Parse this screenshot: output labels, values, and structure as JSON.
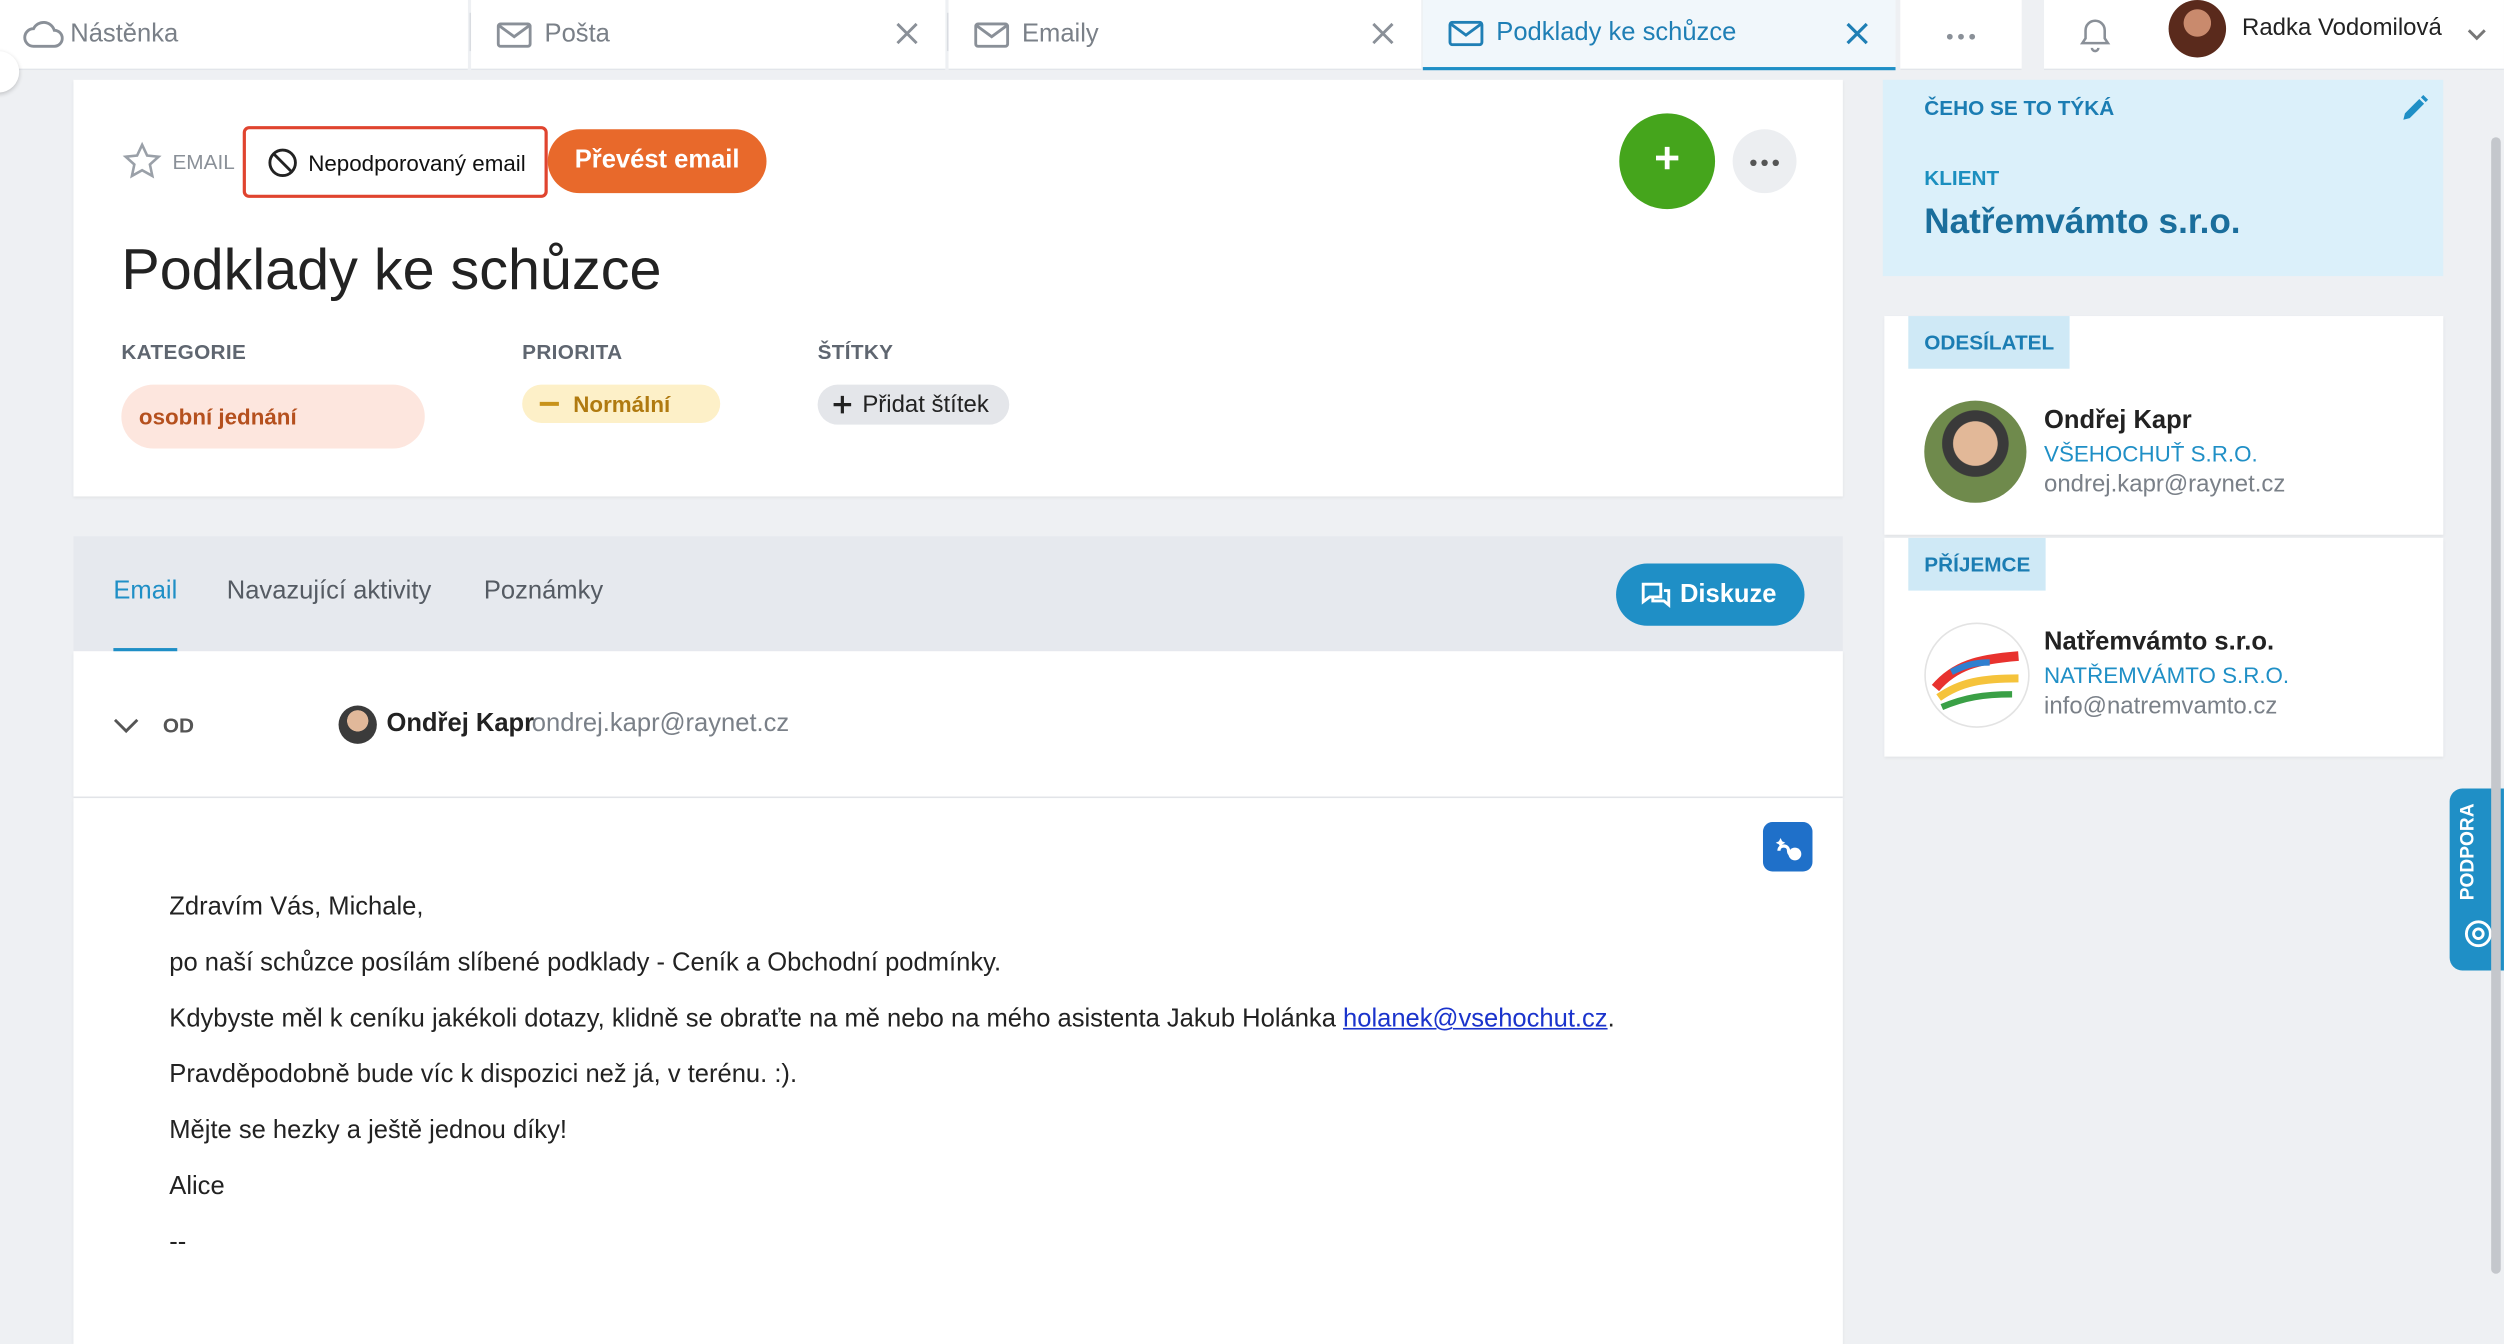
{
  "tabs": [
    {
      "label": "Nástěnka",
      "icon": "cloud-icon"
    },
    {
      "label": "Pošta",
      "icon": "mail-icon"
    },
    {
      "label": "Emaily",
      "icon": "mail-icon"
    },
    {
      "label": "Podklady ke schůzce",
      "icon": "mail-icon"
    }
  ],
  "user": {
    "name": "Radka Vodomilová"
  },
  "record": {
    "type_label": "EMAIL",
    "unsupported_label": "Nepodporovaný email",
    "convert_label": "Převést email",
    "title": "Podklady ke schůzce",
    "fields": {
      "category_label": "KATEGORIE",
      "category_value": "osobní jednání",
      "priority_label": "PRIORITA",
      "priority_value": "Normální",
      "tags_label": "ŠTÍTKY",
      "add_tag_label": "Přidat štítek"
    }
  },
  "subtabs": [
    "Email",
    "Navazující aktivity",
    "Poznámky"
  ],
  "discussion_label": "Diskuze",
  "email": {
    "from_label": "OD",
    "from_name": "Ondřej Kapr",
    "from_email": "ondrej.kapr@raynet.cz",
    "body": {
      "line1": "Zdravím Vás, Michale,",
      "line2": "po naší schůzce posílám slíbené podklady - Ceník a Obchodní podmínky.",
      "line3_prefix": "Kdybyste měl k ceníku jakékoli dotazy, klidně se obraťte na mě nebo na mého asistenta Jakub Holánka ",
      "line3_link": "holanek@vsehochut.cz",
      "line3_suffix": ".",
      "line4": "Pravděpodobně bude víc k dispozici než já, v terénu. :).",
      "line5": "Mějte se hezky a ještě jednou díky!",
      "line6": "Alice",
      "line7": "--"
    }
  },
  "sidebar": {
    "concerns_label": "ČEHO SE TO TÝKÁ",
    "client_label": "KLIENT",
    "client_name": "Natřemvámto s.r.o.",
    "sender": {
      "label": "ODESÍLATEL",
      "name": "Ondřej Kapr",
      "company": "VŠEHOCHUŤ S.R.O.",
      "email": "ondrej.kapr@raynet.cz"
    },
    "recipient": {
      "label": "PŘÍJEMCE",
      "name": "Natřemvámto s.r.o.",
      "company": "NATŘEMVÁMTO S.R.O.",
      "email": "info@natremvamto.cz"
    },
    "support_label": "PODPORA"
  },
  "colors": {
    "accent": "#1f8fc6",
    "orange": "#e8692b",
    "green": "#45a51c",
    "alert_red": "#e0442f"
  }
}
